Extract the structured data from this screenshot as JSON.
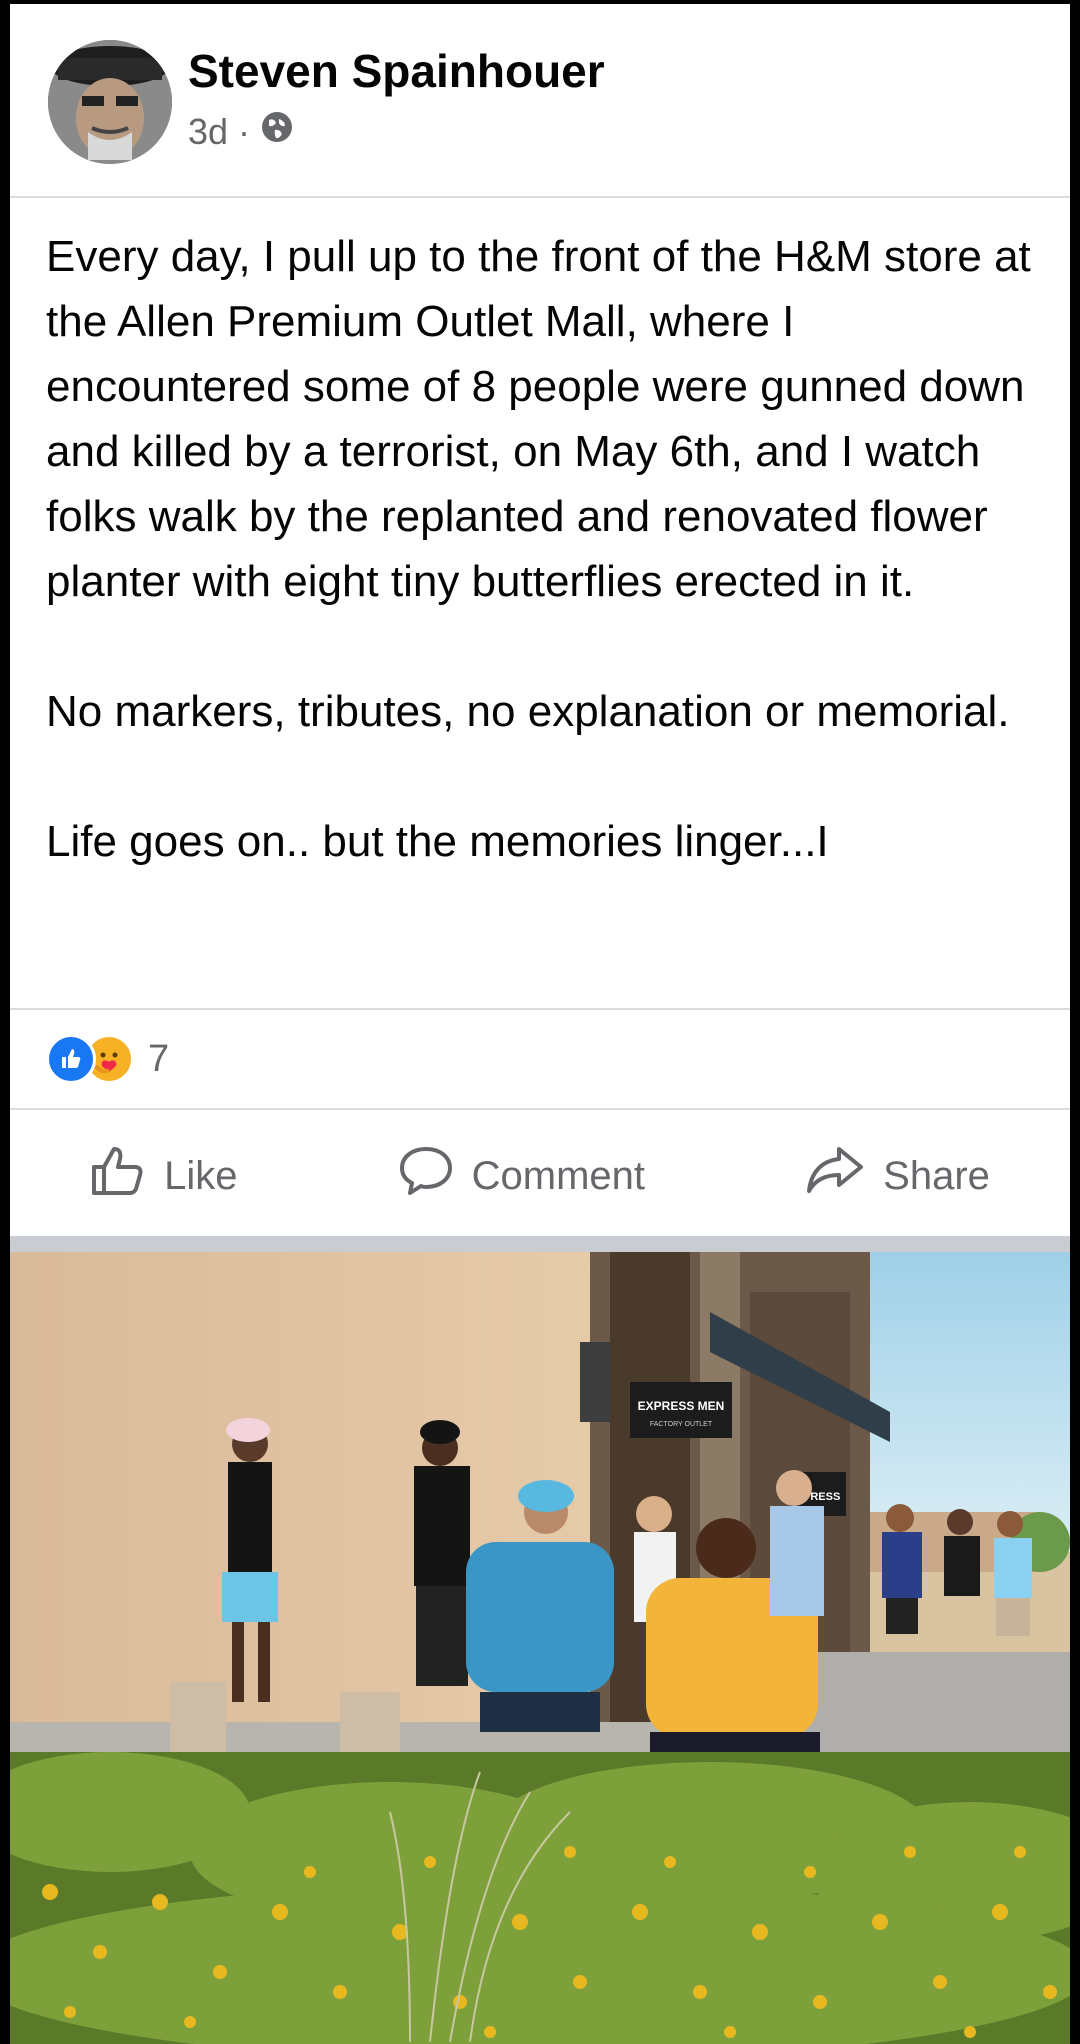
{
  "post": {
    "author": "Steven Spainhouer",
    "time": "3d",
    "separator": "·",
    "paragraphs": [
      "Every day, I pull up to the front of the H&M store at the Allen Premium Outlet Mall, where I encountered some of 8 people were gunned down and killed by a terrorist, on May 6th, and I watch folks walk by the replanted and renovated flower planter with eight tiny butterflies erected in it.",
      "No markers, tributes, no explanation or memorial.",
      "Life goes on.. but the memories linger...I"
    ]
  },
  "reactions": {
    "count": "7",
    "icons": [
      "like-reaction-icon",
      "care-reaction-icon"
    ]
  },
  "actions": {
    "like_label": "Like",
    "comment_label": "Comment",
    "share_label": "Share"
  },
  "photo": {
    "signs": {
      "express_men": "EXPRESS MEN",
      "factory_outlet": "FACTORY OUTLET",
      "xpress": "XPRESS"
    }
  },
  "colors": {
    "accent": "#1877f2",
    "care": "#f7b125",
    "secondary_text": "#65676b"
  }
}
